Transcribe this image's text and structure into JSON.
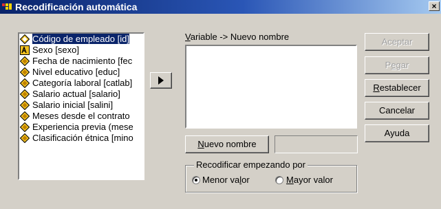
{
  "window": {
    "title": "Recodificación automática",
    "close_glyph": "×"
  },
  "variables": [
    {
      "label": "Código de empleado [id]",
      "icon": "scale-diamond-icon",
      "selected": true
    },
    {
      "label": "Sexo [sexo]",
      "icon": "nominal-string-icon",
      "selected": false
    },
    {
      "label": "Fecha de nacimiento [fec",
      "icon": "scale-diamond-icon",
      "selected": false
    },
    {
      "label": "Nivel educativo [educ]",
      "icon": "scale-diamond-icon",
      "selected": false
    },
    {
      "label": "Categoría laboral [catlab]",
      "icon": "scale-diamond-icon",
      "selected": false
    },
    {
      "label": "Salario actual [salario]",
      "icon": "scale-diamond-icon",
      "selected": false
    },
    {
      "label": "Salario inicial [salini]",
      "icon": "scale-diamond-icon",
      "selected": false
    },
    {
      "label": "Meses desde el contrato",
      "icon": "scale-diamond-icon",
      "selected": false
    },
    {
      "label": "Experiencia previa (mese",
      "icon": "scale-diamond-icon",
      "selected": false
    },
    {
      "label": "Clasificación étnica [mino",
      "icon": "scale-diamond-icon",
      "selected": false
    }
  ],
  "mapping": {
    "label_mnemonic": "V",
    "label_rest": "ariable -> Nuevo nombre",
    "nuevo_mnemonic": "N",
    "nuevo_rest": "uevo nombre",
    "name_value": ""
  },
  "recode_group": {
    "legend": "Recodificar empezando por",
    "menor_pre": "Menor va",
    "menor_mnemonic": "l",
    "menor_post": "or",
    "menor_selected": true,
    "mayor_mnemonic": "M",
    "mayor_rest": "ayor valor",
    "mayor_selected": false
  },
  "buttons": {
    "aceptar": "Aceptar",
    "pegar_pre": "P",
    "pegar_mnemonic": "e",
    "pegar_post": "gar",
    "restablecer_mnemonic": "R",
    "restablecer_rest": "establecer",
    "cancelar": "Cancelar",
    "ayuda": "Ayuda"
  },
  "colors": {
    "title_bar_start": "#0a246a",
    "title_bar_end": "#a6caf0",
    "dialog_face": "#d4d0c8",
    "selection": "#0a246a",
    "scale_icon_fill": "#f0c020"
  }
}
